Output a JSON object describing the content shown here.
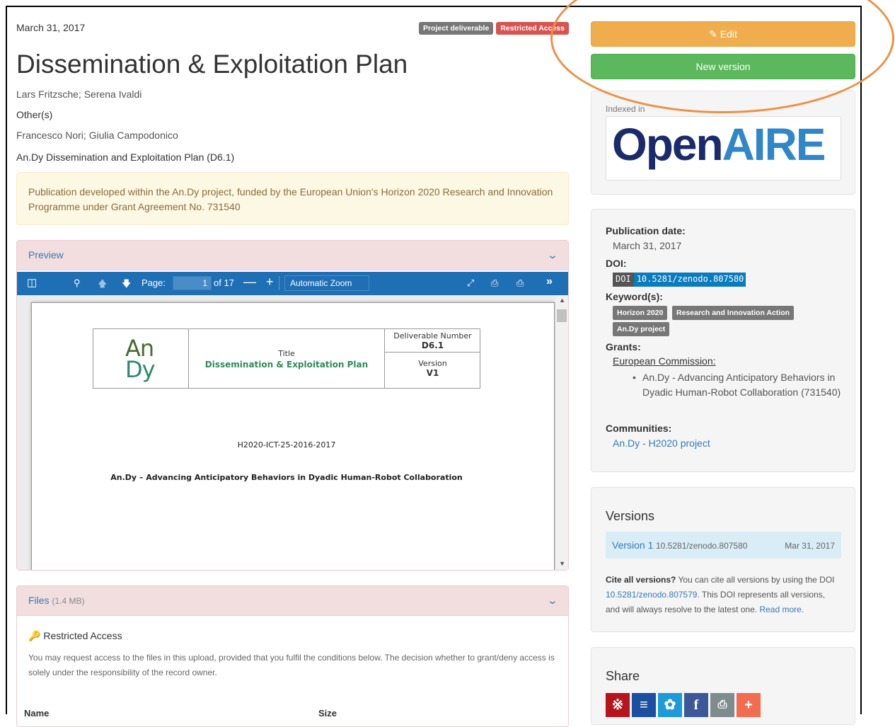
{
  "record": {
    "date": "March 31, 2017",
    "badge_deliverable": "Project deliverable",
    "badge_restricted": "Restricted Access",
    "title": "Dissemination & Exploitation Plan",
    "authors": "Lars Fritzsche; Serena Ivaldi",
    "others_label": "Other(s)",
    "others": "Francesco Nori; Giulia Campodonico",
    "subtitle": "An.Dy Dissemination and Exploitation Plan (D6.1)",
    "notice": "Publication developed within the An.Dy project, funded by the European Union's Horizon 2020 Research and Innovation Programme under Grant Agreement No. 731540"
  },
  "preview": {
    "heading": "Preview",
    "toolbar": {
      "page_label": "Page:",
      "page_value": "1",
      "page_of": "of 17",
      "zoom": "Automatic Zoom"
    },
    "doc": {
      "logo_top": "An",
      "logo_bottom": "Dy",
      "title_label": "Title",
      "title_value": "Dissemination & Exploitation Plan",
      "deliverable_label": "Deliverable Number",
      "deliverable_value": "D6.1",
      "version_label": "Version",
      "version_value": "V1",
      "code": "H2020-ICT-25-2016-2017",
      "full_title": "An.Dy – Advancing Anticipatory Behaviors in Dyadic Human-Robot Collaboration"
    }
  },
  "files": {
    "heading": "Files",
    "size": "(1.4 MB)",
    "restricted_title": "Restricted Access",
    "restricted_text": "You may request access to the files in this upload, provided that you fulfil the conditions below. The decision whether to grant/deny access is solely under the responsibility of the record owner.",
    "col_name": "Name",
    "col_size": "Size"
  },
  "sidebar": {
    "edit_label": "Edit",
    "new_version_label": "New version",
    "indexed_in": "Indexed in",
    "openaire_open": "Open",
    "openaire_aire": "AIRE",
    "pub_date_label": "Publication date:",
    "pub_date_value": "March 31, 2017",
    "doi_label": "DOI:",
    "doi_prefix": "DOI",
    "doi_value": "10.5281/zenodo.807580",
    "keywords_label": "Keyword(s):",
    "keywords": [
      "Horizon 2020",
      "Research and Innovation Action",
      "An.Dy project"
    ],
    "grants_label": "Grants:",
    "grant_funder": "European Commission:",
    "grant_item": "An.Dy - Advancing Anticipatory Behaviors in Dyadic Human-Robot Collaboration (731540)",
    "communities_label": "Communities:",
    "community": "An.Dy - H2020 project"
  },
  "versions": {
    "title": "Versions",
    "version_link": "Version 1",
    "version_doi": "10.5281/zenodo.807580",
    "version_date": "Mar 31, 2017",
    "cite_bold": "Cite all versions?",
    "cite_text1": " You can cite all versions by using the DOI ",
    "cite_doi": "10.5281/zenodo.807579",
    "cite_text2": ". This DOI represents all versions, and will always resolve to the latest one. ",
    "read_more": "Read more."
  },
  "share": {
    "title": "Share"
  },
  "colors": {
    "edit": "#f0ad4e",
    "new_version": "#5cb85c",
    "annotation_oval": "#ee9043",
    "toolbar": "#1f6fb5"
  }
}
